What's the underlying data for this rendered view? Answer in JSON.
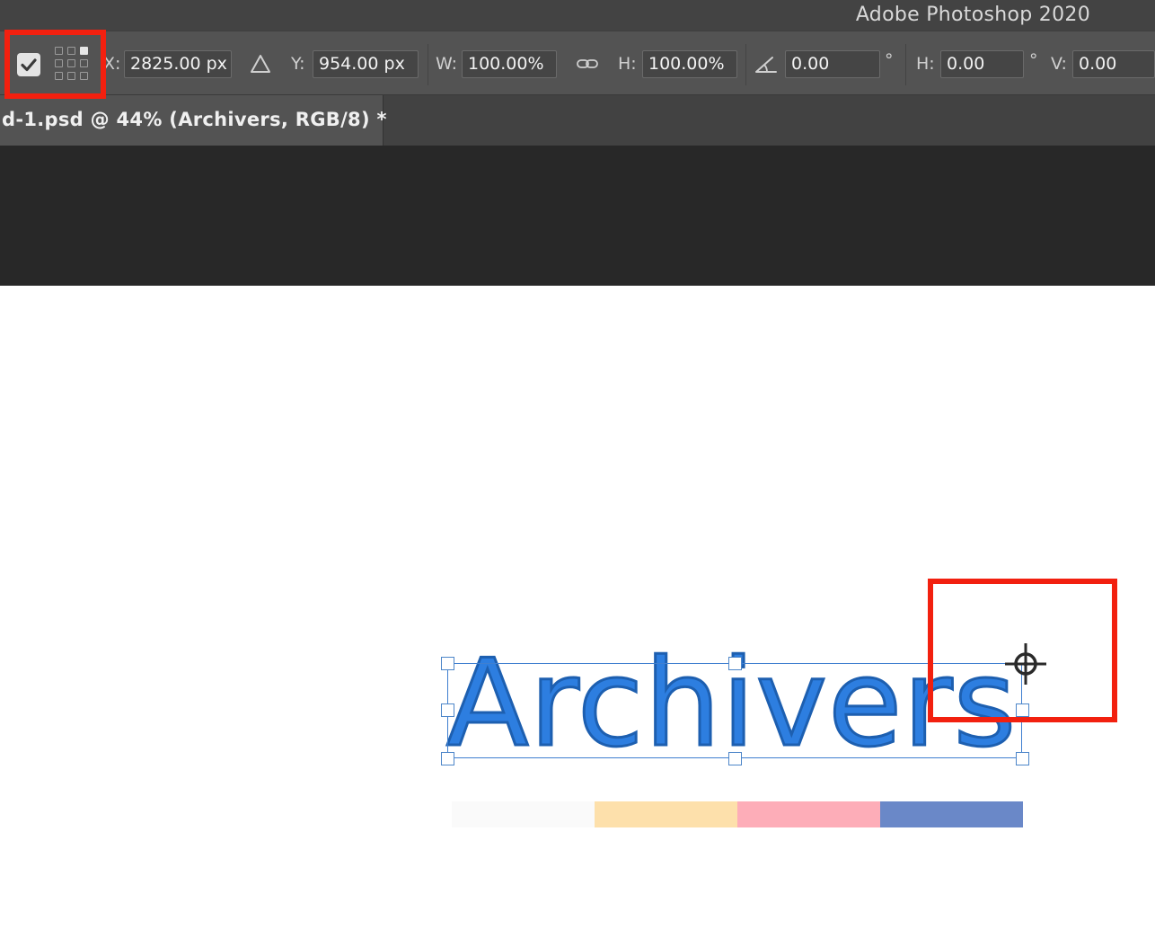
{
  "window": {
    "title": "Adobe Photoshop 2020"
  },
  "options_bar": {
    "use_reference_point_checked": true,
    "reference_point_active": "top-right",
    "x_label": "X:",
    "x_value": "2825.00 px",
    "y_label": "Y:",
    "y_value": "954.00 px",
    "w_label": "W:",
    "w_value": "100.00%",
    "h_label": "H:",
    "h_value": "100.00%",
    "angle_value": "0.00",
    "angle_unit": "°",
    "skew_h_label": "H:",
    "skew_h_value": "0.00",
    "skew_h_unit": "°",
    "skew_v_label": "V:",
    "skew_v_value": "0.00"
  },
  "document_tab": {
    "label": "d-1.psd @ 44% (Archivers, RGB/8) *"
  },
  "canvas": {
    "text_layer": "Archivers",
    "text_color": "#2d7ee0",
    "swatches": [
      "#fafafa",
      "#fde0ab",
      "#fdadb8",
      "#6a88c8"
    ]
  },
  "annotations": {
    "highlight_color": "#f2200f"
  }
}
